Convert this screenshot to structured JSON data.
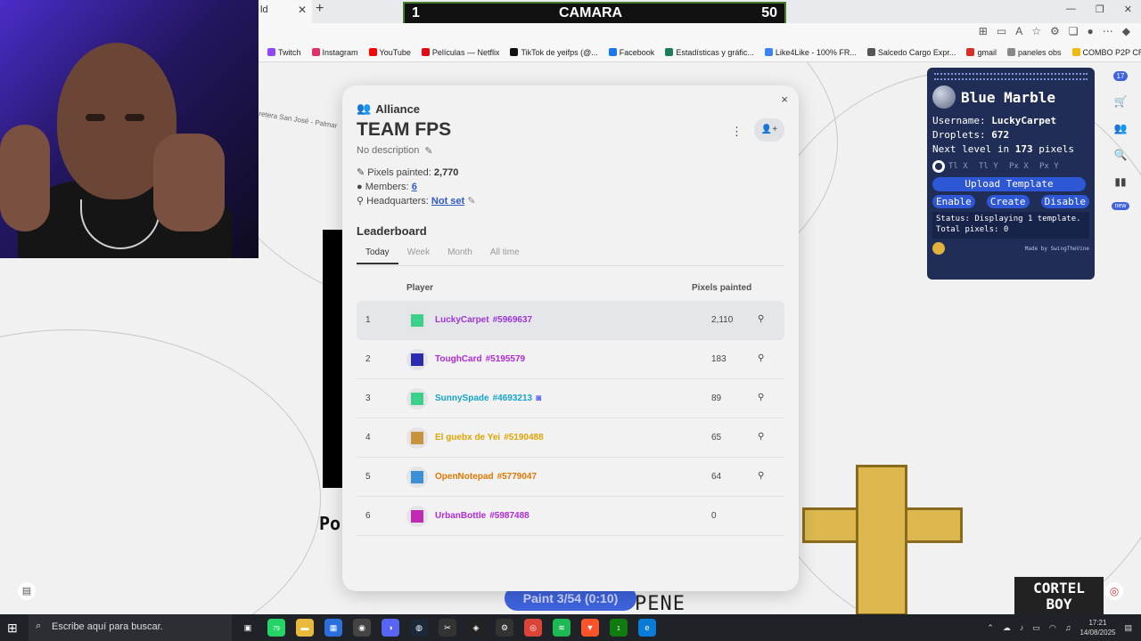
{
  "browser": {
    "tab_fragment": "ld",
    "tab_close": "✕",
    "tab_new": "+",
    "window_controls": [
      "—",
      "❐",
      "✕"
    ]
  },
  "camera_bar": {
    "left": "1",
    "title": "CAMARA",
    "right": "50"
  },
  "bookmarks": [
    {
      "label": "Twitch",
      "color": "#9146ff"
    },
    {
      "label": "Instagram",
      "color": "#e1306c"
    },
    {
      "label": "YouTube",
      "color": "#ff0000"
    },
    {
      "label": "Películas — Netflix",
      "color": "#e50914"
    },
    {
      "label": "TikTok de yeifps (@...",
      "color": "#111111"
    },
    {
      "label": "Facebook",
      "color": "#1877f2"
    },
    {
      "label": "Estadísticas y gráfic...",
      "color": "#1b7f5a"
    },
    {
      "label": "Like4Like - 100% FR...",
      "color": "#3b82f6"
    },
    {
      "label": "Salcedo Cargo Expr...",
      "color": "#555555"
    },
    {
      "label": "gmail",
      "color": "#d93025"
    },
    {
      "label": "paneles obs",
      "color": "#888888"
    },
    {
      "label": "COMBO P2P CREAT...",
      "color": "#f0b90b"
    }
  ],
  "map": {
    "road_label": "retera San José - Palmar",
    "art_po": "Po",
    "art_pene": "PENE",
    "art_cortel": [
      "CORTEL",
      "BOY"
    ],
    "paint_button": "Paint 3/54 (0:10)"
  },
  "side_tools": {
    "badge_count": "17",
    "new_badge": "new"
  },
  "blue_marble": {
    "title": "Blue Marble",
    "username_label": "Username:",
    "username": "LuckyCarpet",
    "droplets_label": "Droplets:",
    "droplets": "672",
    "next_level_prefix": "Next level in",
    "next_level_value": "173",
    "next_level_suffix": "pixels",
    "coord_placeholders": [
      "Tl X",
      "Tl Y",
      "Px X",
      "Px Y"
    ],
    "upload_button": "Upload Template",
    "enable_button": "Enable",
    "create_button": "Create",
    "disable_button": "Disable",
    "status_text": "Status: Displaying 1 template. Total pixels: 0",
    "footer": "Made by SwingTheVine"
  },
  "modal": {
    "close": "×",
    "section_label": "Alliance",
    "team_name": "TEAM FPS",
    "description": "No description",
    "pixels_label": "Pixels painted:",
    "pixels_value": "2,770",
    "members_label": "Members:",
    "members_value": "6",
    "hq_label": "Headquarters:",
    "hq_value": "Not set",
    "leaderboard_title": "Leaderboard",
    "tabs": [
      "Today",
      "Week",
      "Month",
      "All time"
    ],
    "col_player": "Player",
    "col_pixels": "Pixels painted",
    "rows": [
      {
        "rank": "1",
        "name": "LuckyCarpet",
        "id": "#5969637",
        "pixels": "2,110",
        "color": "#9b35d6",
        "avatar_color": "#3ad18a",
        "discord": false,
        "has_location": true
      },
      {
        "rank": "2",
        "name": "ToughCard",
        "id": "#5195579",
        "pixels": "183",
        "color": "#b22ad6",
        "avatar_color": "#2b2bb0",
        "discord": false,
        "has_location": true
      },
      {
        "rank": "3",
        "name": "SunnySpade",
        "id": "#4693213",
        "pixels": "89",
        "color": "#16a3c9",
        "avatar_color": "#3ad18a",
        "discord": true,
        "has_location": true
      },
      {
        "rank": "4",
        "name": "El guebx de Yei",
        "id": "#5190488",
        "pixels": "65",
        "color": "#e0a400",
        "avatar_color": "#c8913a",
        "discord": false,
        "has_location": true
      },
      {
        "rank": "5",
        "name": "OpenNotepad",
        "id": "#5779047",
        "pixels": "64",
        "color": "#e07800",
        "avatar_color": "#3b8fd6",
        "discord": false,
        "has_location": true
      },
      {
        "rank": "6",
        "name": "UrbanBottle",
        "id": "#5987488",
        "pixels": "0",
        "color": "#b22ad6",
        "avatar_color": "#c22ab5",
        "discord": false,
        "has_location": false
      }
    ]
  },
  "taskbar": {
    "search_placeholder": "Escribe aquí para buscar.",
    "whatsapp_badge": "79",
    "xbox_badge": "1",
    "time": "17:21",
    "date": "14/08/2025"
  }
}
